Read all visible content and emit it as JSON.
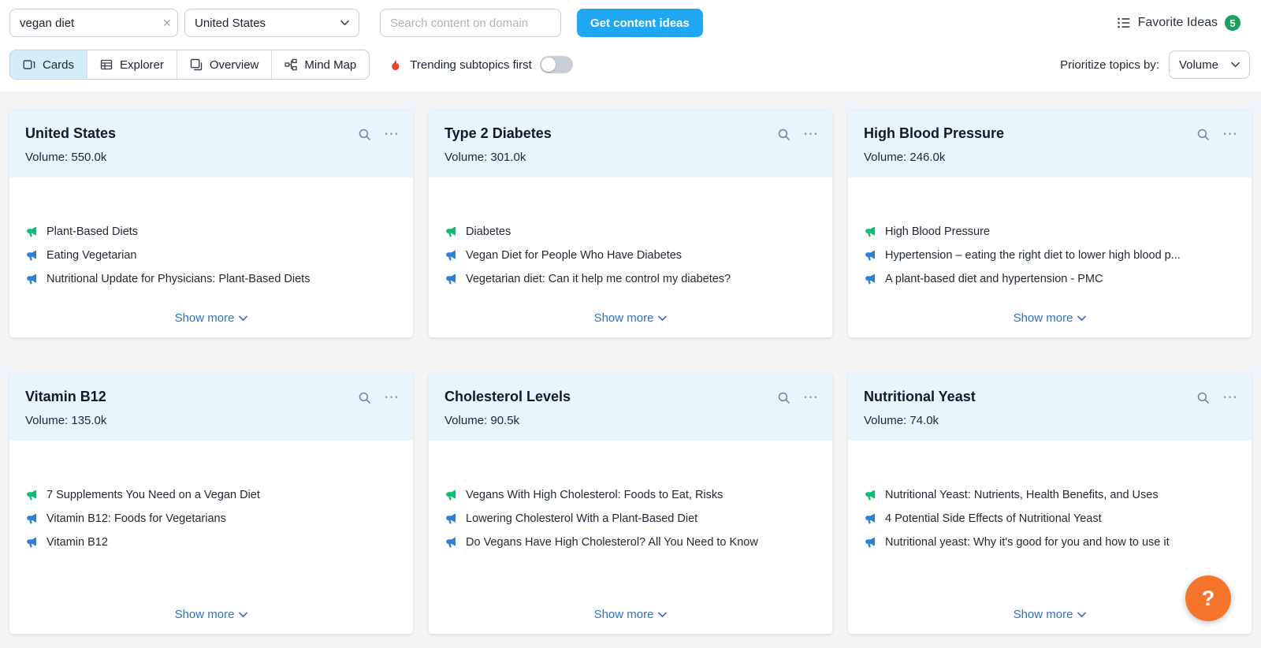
{
  "colors": {
    "primary_blue": "#1fa8f1",
    "link_blue": "#2d71c4",
    "green_megaphone": "#0abf71",
    "blue_megaphone": "#2e7fd9",
    "badge_green": "#1d9f5f",
    "help_orange": "#f4742c",
    "card_header_bg": "#e9f5fd",
    "tab_selected_bg": "#d5ecfa"
  },
  "topbar": {
    "keyword_input": {
      "value": "vegan diet",
      "clear_icon": "×"
    },
    "country_select": {
      "value": "United States"
    },
    "domain_input": {
      "placeholder": "Search content on domain"
    },
    "cta_button": "Get content ideas",
    "favorites": {
      "label": "Favorite Ideas",
      "count": "5"
    }
  },
  "toolbar": {
    "tabs": [
      {
        "label": "Cards",
        "selected": true
      },
      {
        "label": "Explorer",
        "selected": false
      },
      {
        "label": "Overview",
        "selected": false
      },
      {
        "label": "Mind Map",
        "selected": false
      }
    ],
    "trending_toggle": {
      "label": "Trending subtopics first",
      "state": "off"
    },
    "prioritize": {
      "label": "Prioritize topics by:",
      "value": "Volume"
    }
  },
  "labels": {
    "show_more": "Show more",
    "ellipsis_icon": "⋯",
    "help_icon": "?"
  },
  "cards": [
    {
      "title": "United States",
      "volume": "Volume: 550.0k",
      "items": [
        {
          "text": "Plant-Based Diets",
          "icon_color": "green"
        },
        {
          "text": "Eating Vegetarian",
          "icon_color": "blue"
        },
        {
          "text": "Nutritional Update for Physicians: Plant-Based Diets",
          "icon_color": "blue"
        }
      ]
    },
    {
      "title": "Type 2 Diabetes",
      "volume": "Volume: 301.0k",
      "items": [
        {
          "text": "Diabetes",
          "icon_color": "green"
        },
        {
          "text": "Vegan Diet for People Who Have Diabetes",
          "icon_color": "blue"
        },
        {
          "text": "Vegetarian diet: Can it help me control my diabetes?",
          "icon_color": "blue"
        }
      ]
    },
    {
      "title": "High Blood Pressure",
      "volume": "Volume: 246.0k",
      "items": [
        {
          "text": "High Blood Pressure",
          "icon_color": "green"
        },
        {
          "text": "Hypertension – eating the right diet to lower high blood p...",
          "icon_color": "blue"
        },
        {
          "text": "A plant-based diet and hypertension - PMC",
          "icon_color": "blue"
        }
      ]
    },
    {
      "title": "Vitamin B12",
      "volume": "Volume: 135.0k",
      "items": [
        {
          "text": "7 Supplements You Need on a Vegan Diet",
          "icon_color": "green"
        },
        {
          "text": "Vitamin B12: Foods for Vegetarians",
          "icon_color": "blue"
        },
        {
          "text": "Vitamin B12",
          "icon_color": "blue"
        }
      ]
    },
    {
      "title": "Cholesterol Levels",
      "volume": "Volume: 90.5k",
      "items": [
        {
          "text": "Vegans With High Cholesterol: Foods to Eat, Risks",
          "icon_color": "green"
        },
        {
          "text": "Lowering Cholesterol With a Plant-Based Diet",
          "icon_color": "blue"
        },
        {
          "text": "Do Vegans Have High Cholesterol? All You Need to Know",
          "icon_color": "blue"
        }
      ]
    },
    {
      "title": "Nutritional Yeast",
      "volume": "Volume: 74.0k",
      "items": [
        {
          "text": "Nutritional Yeast: Nutrients, Health Benefits, and Uses",
          "icon_color": "green"
        },
        {
          "text": "4 Potential Side Effects of Nutritional Yeast",
          "icon_color": "blue"
        },
        {
          "text": "Nutritional yeast: Why it's good for you and how to use it",
          "icon_color": "blue"
        }
      ]
    }
  ]
}
